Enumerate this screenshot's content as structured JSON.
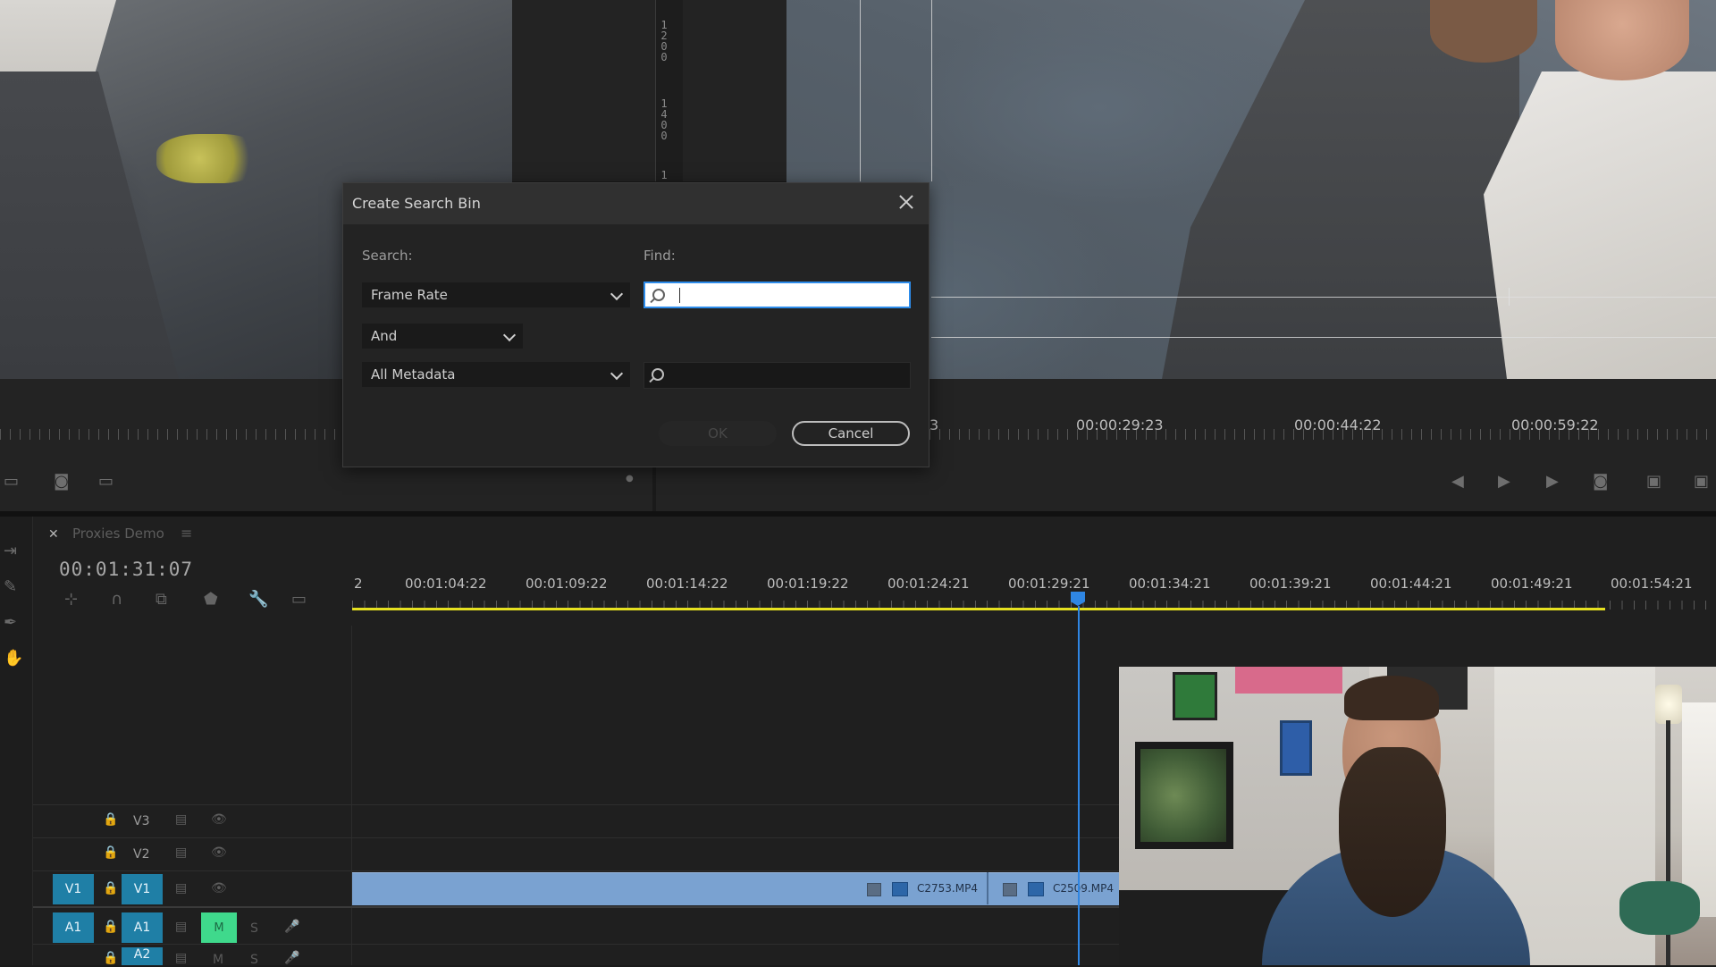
{
  "dialog": {
    "title": "Create Search Bin",
    "search_label": "Search:",
    "find_label": "Find:",
    "search_field_1": "Frame Rate",
    "operator": "And",
    "search_field_2": "All Metadata",
    "find_value_1": "",
    "find_value_2": "",
    "ok_label": "OK",
    "cancel_label": "Cancel"
  },
  "source_monitor": {
    "ruler_top": "1200",
    "ruler_mid": "1400",
    "ruler_bottom": "1"
  },
  "program_monitor": {
    "time_partial": "3",
    "times": [
      "00:00:29:23",
      "00:00:44:22",
      "00:00:59:22"
    ]
  },
  "timeline": {
    "tab_name": "Proxies Demo",
    "timecode": "00:01:31:07",
    "ruler_first": "2",
    "ruler_times": [
      "00:01:04:22",
      "00:01:09:22",
      "00:01:14:22",
      "00:01:19:22",
      "00:01:24:21",
      "00:01:29:21",
      "00:01:34:21",
      "00:01:39:21",
      "00:01:44:21",
      "00:01:49:21",
      "00:01:54:21"
    ],
    "tracks": {
      "v3": "V3",
      "v2": "V2",
      "v1_src": "V1",
      "v1": "V1",
      "a1_src": "A1",
      "a1": "A1",
      "a1_mute": "M",
      "a1_solo": "S",
      "a2": "A2",
      "a2_mute": "M",
      "a2_solo": "S"
    },
    "clips": [
      {
        "name": "C2753.MP4"
      },
      {
        "name": "C2509.MP4"
      }
    ]
  },
  "colors": {
    "playhead": "#2f86e3",
    "work_area": "#e5e020",
    "clip": "#7aa2d1",
    "track_target": "#1f7fa6",
    "mute_on": "#3fd98c"
  }
}
